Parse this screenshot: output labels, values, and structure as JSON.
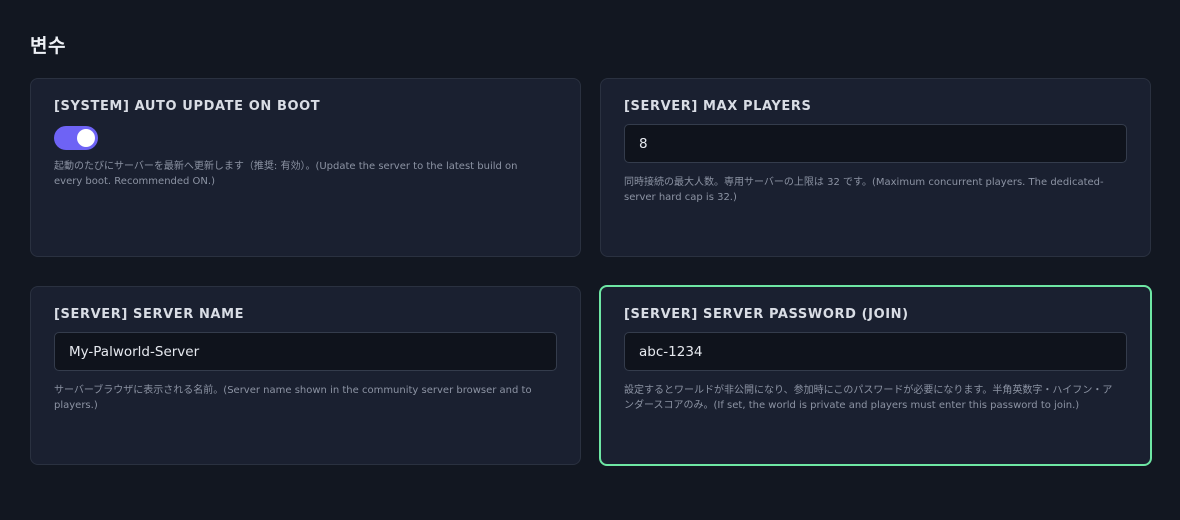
{
  "page": {
    "title": "변수"
  },
  "variables": [
    {
      "label": "[SYSTEM] AUTO UPDATE ON BOOT",
      "type": "toggle",
      "enabled": true,
      "description": "起動のたびにサーバーを最新へ更新します（推奨: 有効）。(Update the server to the latest build on every boot. Recommended ON.)"
    },
    {
      "label": "[SERVER] MAX PLAYERS",
      "type": "text",
      "value": "8",
      "description": "同時接続の最大人数。専用サーバーの上限は 32 です。(Maximum concurrent players. The dedicated-server hard cap is 32.)"
    },
    {
      "label": "[SERVER] SERVER NAME",
      "type": "text",
      "value": "My-Palworld-Server",
      "description": "サーバーブラウザに表示される名前。(Server name shown in the community server browser and to players.)"
    },
    {
      "label": "[SERVER] SERVER PASSWORD (JOIN)",
      "type": "text",
      "value": "abc-1234",
      "focused": true,
      "description": "設定するとワールドが非公開になり、参加時にこのパスワードが必要になります。半角英数字・ハイフン・アンダースコアのみ。(If set, the world is private and players must enter this password to join.)"
    }
  ],
  "colors": {
    "background": "#121721",
    "card": "#1a2030",
    "toggle_on": "#6e63f5",
    "focus_border": "#6ee7a4"
  }
}
